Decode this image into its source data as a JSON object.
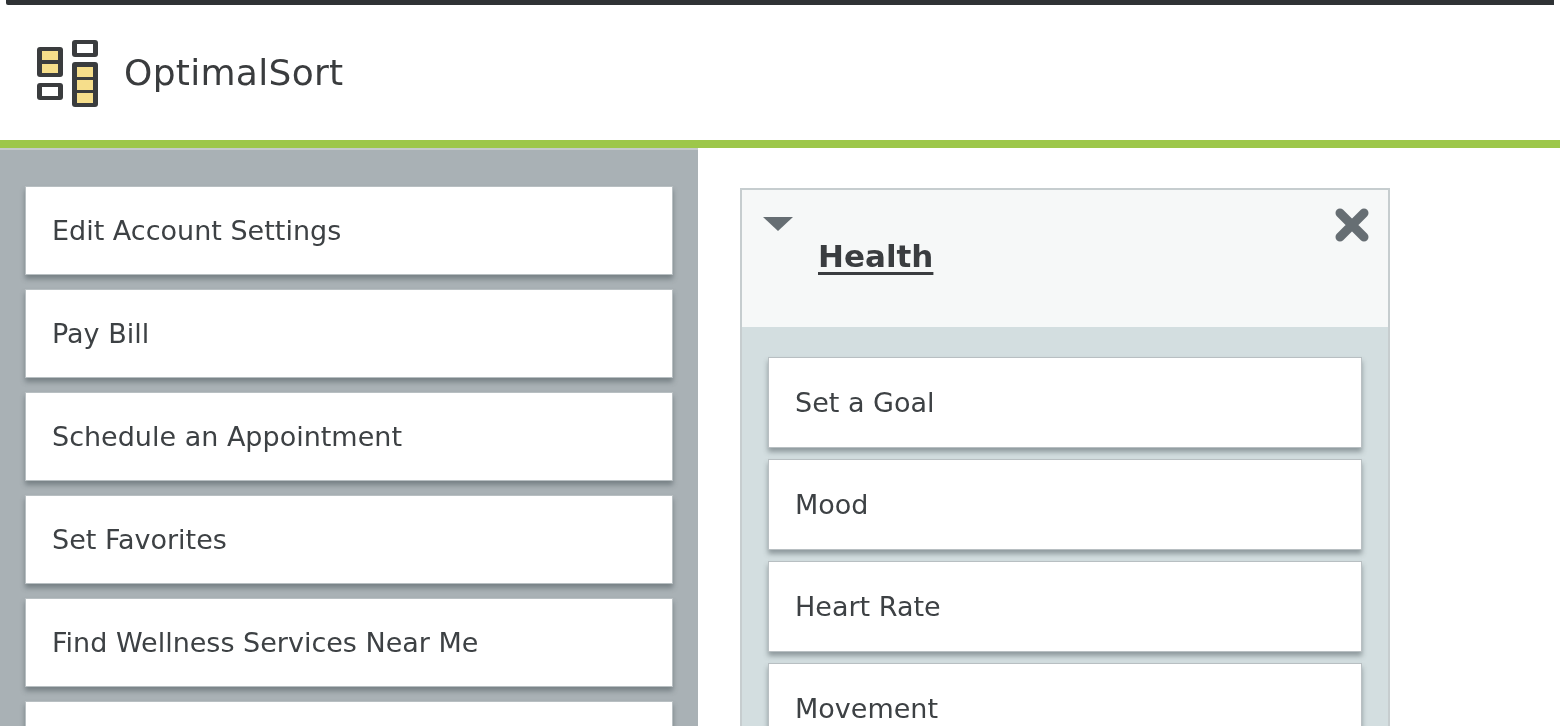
{
  "header": {
    "title": "OptimalSort"
  },
  "cards": [
    {
      "label": "Edit Account Settings"
    },
    {
      "label": "Pay Bill"
    },
    {
      "label": "Schedule an Appointment"
    },
    {
      "label": "Set Favorites"
    },
    {
      "label": "Find Wellness Services Near Me"
    }
  ],
  "cards_more_below": true,
  "category": {
    "title": "Health",
    "expanded": true,
    "cards": [
      {
        "label": "Set a Goal"
      },
      {
        "label": "Mood"
      },
      {
        "label": "Heart Rate"
      },
      {
        "label": "Movement"
      }
    ]
  }
}
